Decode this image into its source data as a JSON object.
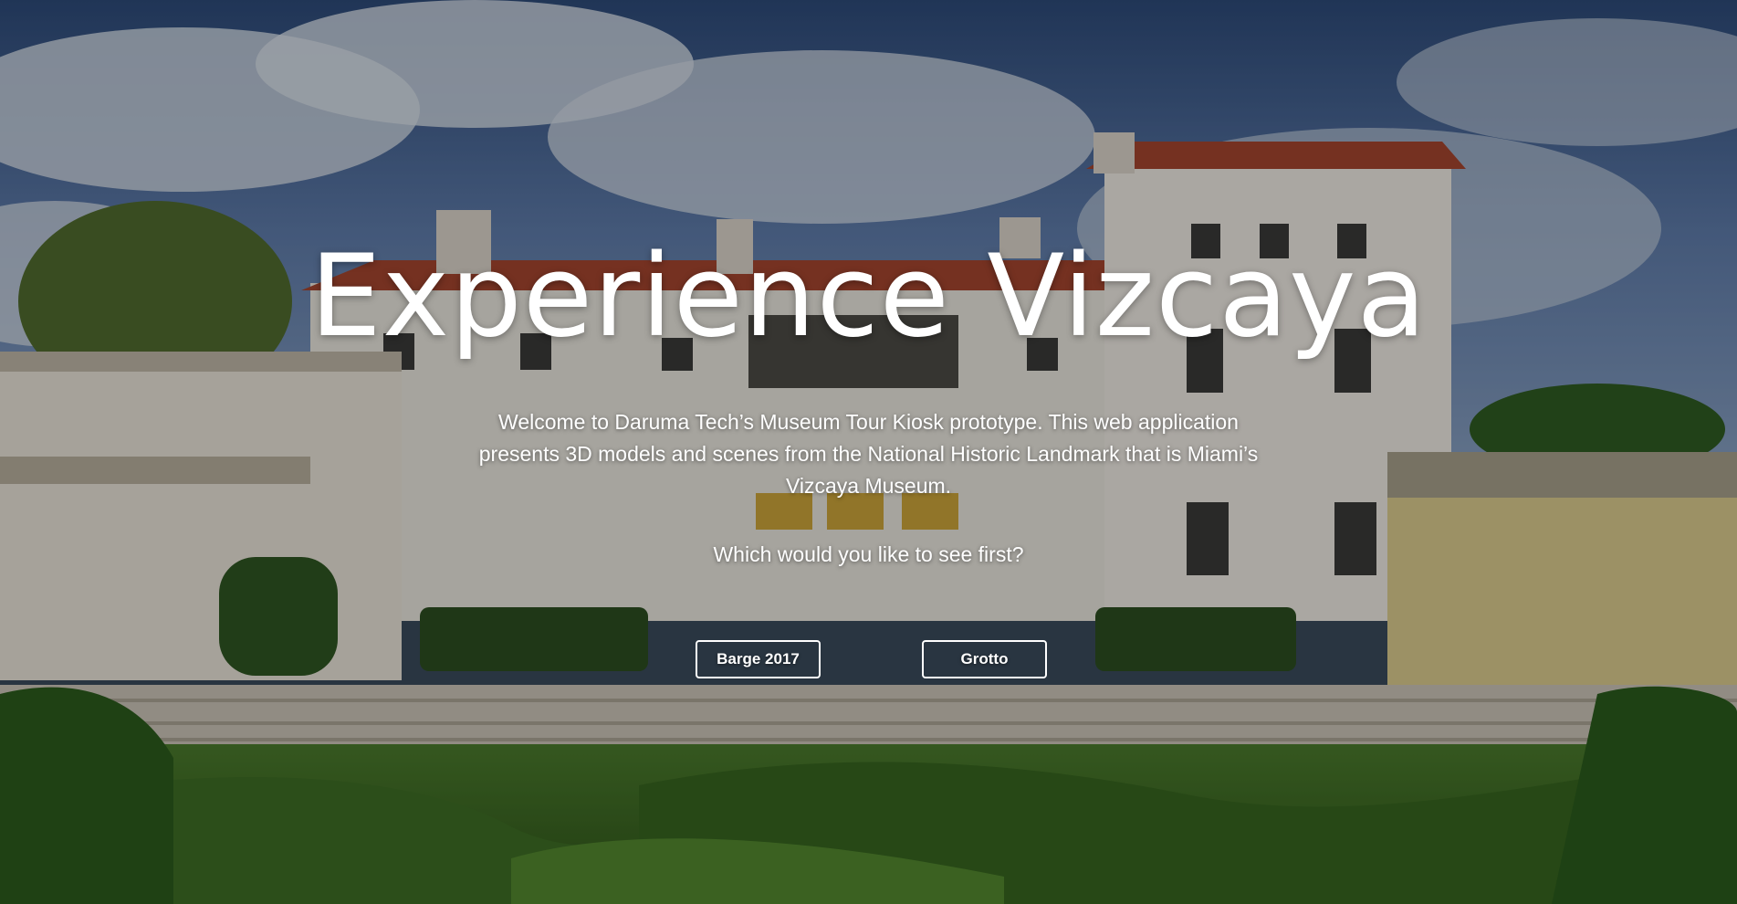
{
  "hero": {
    "title": "Experience Vizcaya",
    "intro": "Welcome to Daruma Tech’s Museum Tour Kiosk prototype. This web application presents 3D models and scenes from the National Historic Landmark that is Miami’s Vizcaya Museum.",
    "question": "Which would you like to see first?",
    "buttons": [
      {
        "label": "Barge 2017"
      },
      {
        "label": "Grotto"
      }
    ],
    "background_image": "vizcaya-museum-villa-photo"
  },
  "colors": {
    "text": "#ffffff",
    "button_border": "#ffffff"
  }
}
